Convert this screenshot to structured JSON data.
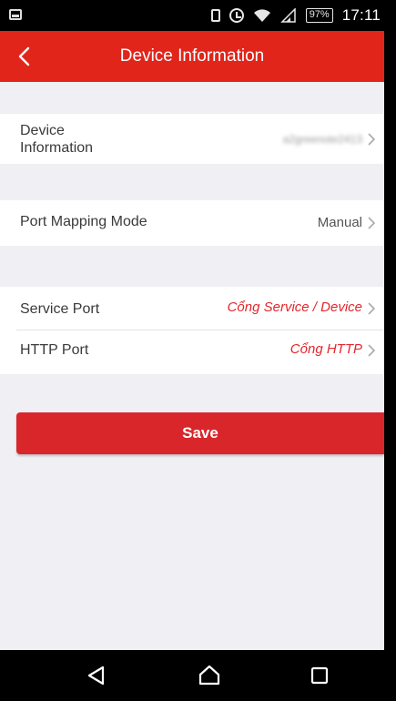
{
  "status_bar": {
    "battery": "97%",
    "time": "17:11"
  },
  "header": {
    "title": "Device Information"
  },
  "rows": {
    "device_information": {
      "label_line1": "Device",
      "label_line2": "Information",
      "value": "a2greenote2413"
    },
    "port_mapping_mode": {
      "label": "Port Mapping Mode",
      "value": "Manual"
    },
    "service_port": {
      "label": "Service Port",
      "value": "Cổng Service / Device"
    },
    "http_port": {
      "label": "HTTP Port",
      "value": "Cổng HTTP"
    }
  },
  "save_button": {
    "label": "Save"
  },
  "colors": {
    "accent_red": "#e1251b",
    "annotation_red": "#e3262c",
    "background": "#efeff4"
  },
  "nav_bar": {
    "icons": [
      "back-triangle-icon",
      "home-icon",
      "recents-square-icon"
    ]
  }
}
